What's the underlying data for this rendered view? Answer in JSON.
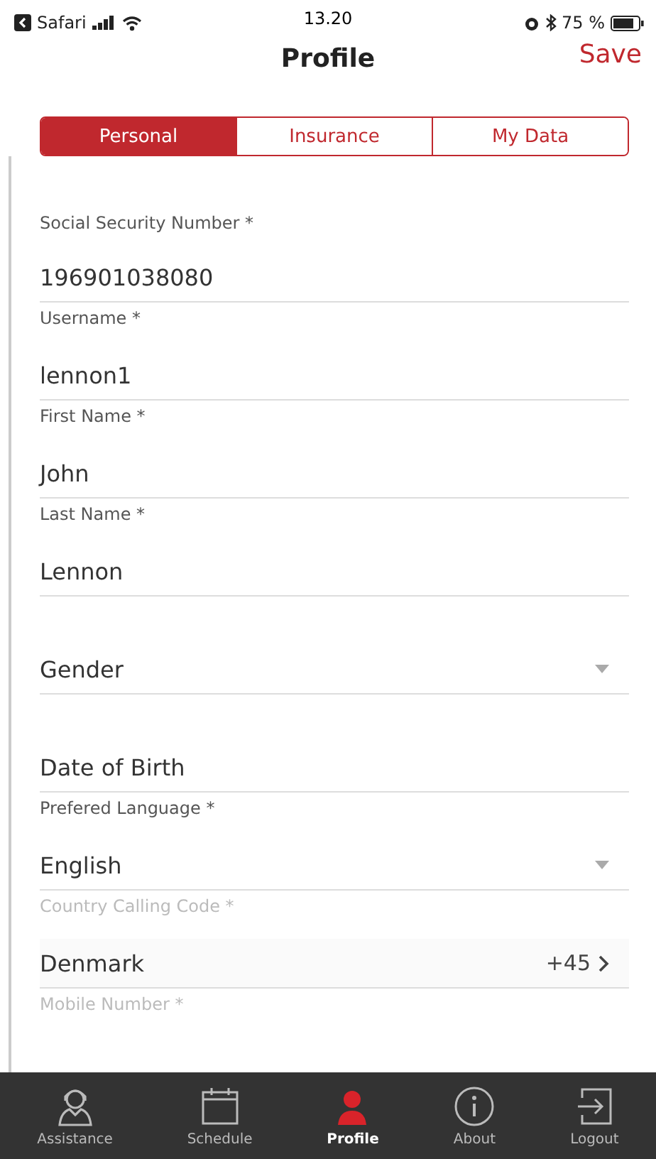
{
  "status_bar": {
    "back_app": "Safari",
    "time": "13.20",
    "battery": "75 %"
  },
  "nav": {
    "title": "Profile",
    "action": "Save"
  },
  "tabs": [
    {
      "label": "Personal",
      "selected": true
    },
    {
      "label": "Insurance",
      "selected": false
    },
    {
      "label": "My Data",
      "selected": false
    }
  ],
  "fields": [
    {
      "kind": "text",
      "label": "Social Security Number *",
      "value": "196901038080",
      "disabled": false
    },
    {
      "kind": "text",
      "label": "Username *",
      "value": "lennon1",
      "disabled": false
    },
    {
      "kind": "text",
      "label": "First Name *",
      "value": "John",
      "disabled": false
    },
    {
      "kind": "text",
      "label": "Last Name *",
      "value": "Lennon",
      "disabled": false
    },
    {
      "kind": "select",
      "placeholder": "Gender"
    },
    {
      "kind": "text",
      "placeholder": "Date of Birth"
    },
    {
      "kind": "select",
      "label": "Prefered Language *",
      "value": "English",
      "disabled": false
    },
    {
      "kind": "link",
      "label": "Country Calling Code *",
      "value": "Denmark",
      "detail": "+45",
      "disabled": true
    },
    {
      "kind": "text",
      "label": "Mobile Number *",
      "disabled": true
    }
  ],
  "tab_bar": [
    {
      "label": "Assistance",
      "selected": false
    },
    {
      "label": "Schedule",
      "selected": false
    },
    {
      "label": "Profile",
      "selected": true
    },
    {
      "label": "About",
      "selected": false
    },
    {
      "label": "Logout",
      "selected": false
    }
  ]
}
